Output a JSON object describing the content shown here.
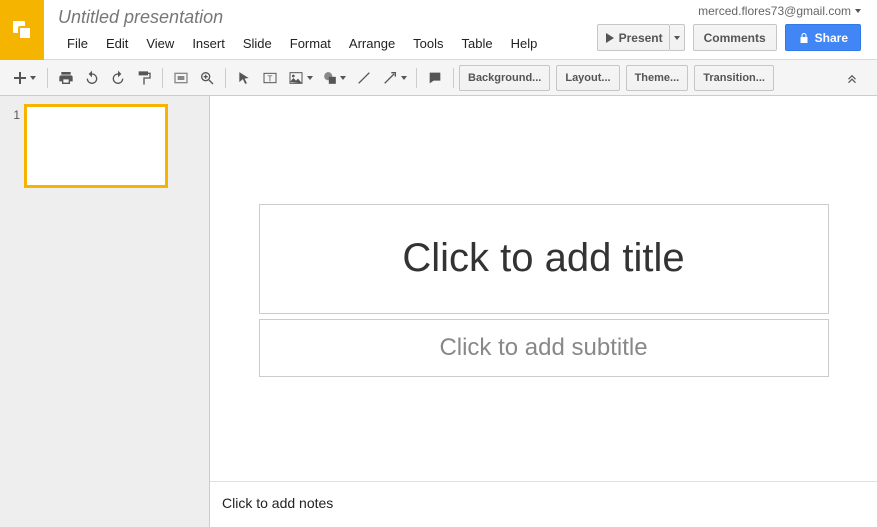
{
  "header": {
    "doc_title": "Untitled presentation",
    "user_email": "merced.flores73@gmail.com",
    "menus": [
      "File",
      "Edit",
      "View",
      "Insert",
      "Slide",
      "Format",
      "Arrange",
      "Tools",
      "Table",
      "Help"
    ],
    "present": "Present",
    "comments": "Comments",
    "share": "Share"
  },
  "toolbar": {
    "background": "Background...",
    "layout": "Layout...",
    "theme": "Theme...",
    "transition": "Transition..."
  },
  "filmstrip": {
    "slide1_num": "1"
  },
  "slide": {
    "title_placeholder": "Click to add title",
    "subtitle_placeholder": "Click to add subtitle"
  },
  "notes": {
    "placeholder": "Click to add notes"
  },
  "splitter_dots": "..."
}
